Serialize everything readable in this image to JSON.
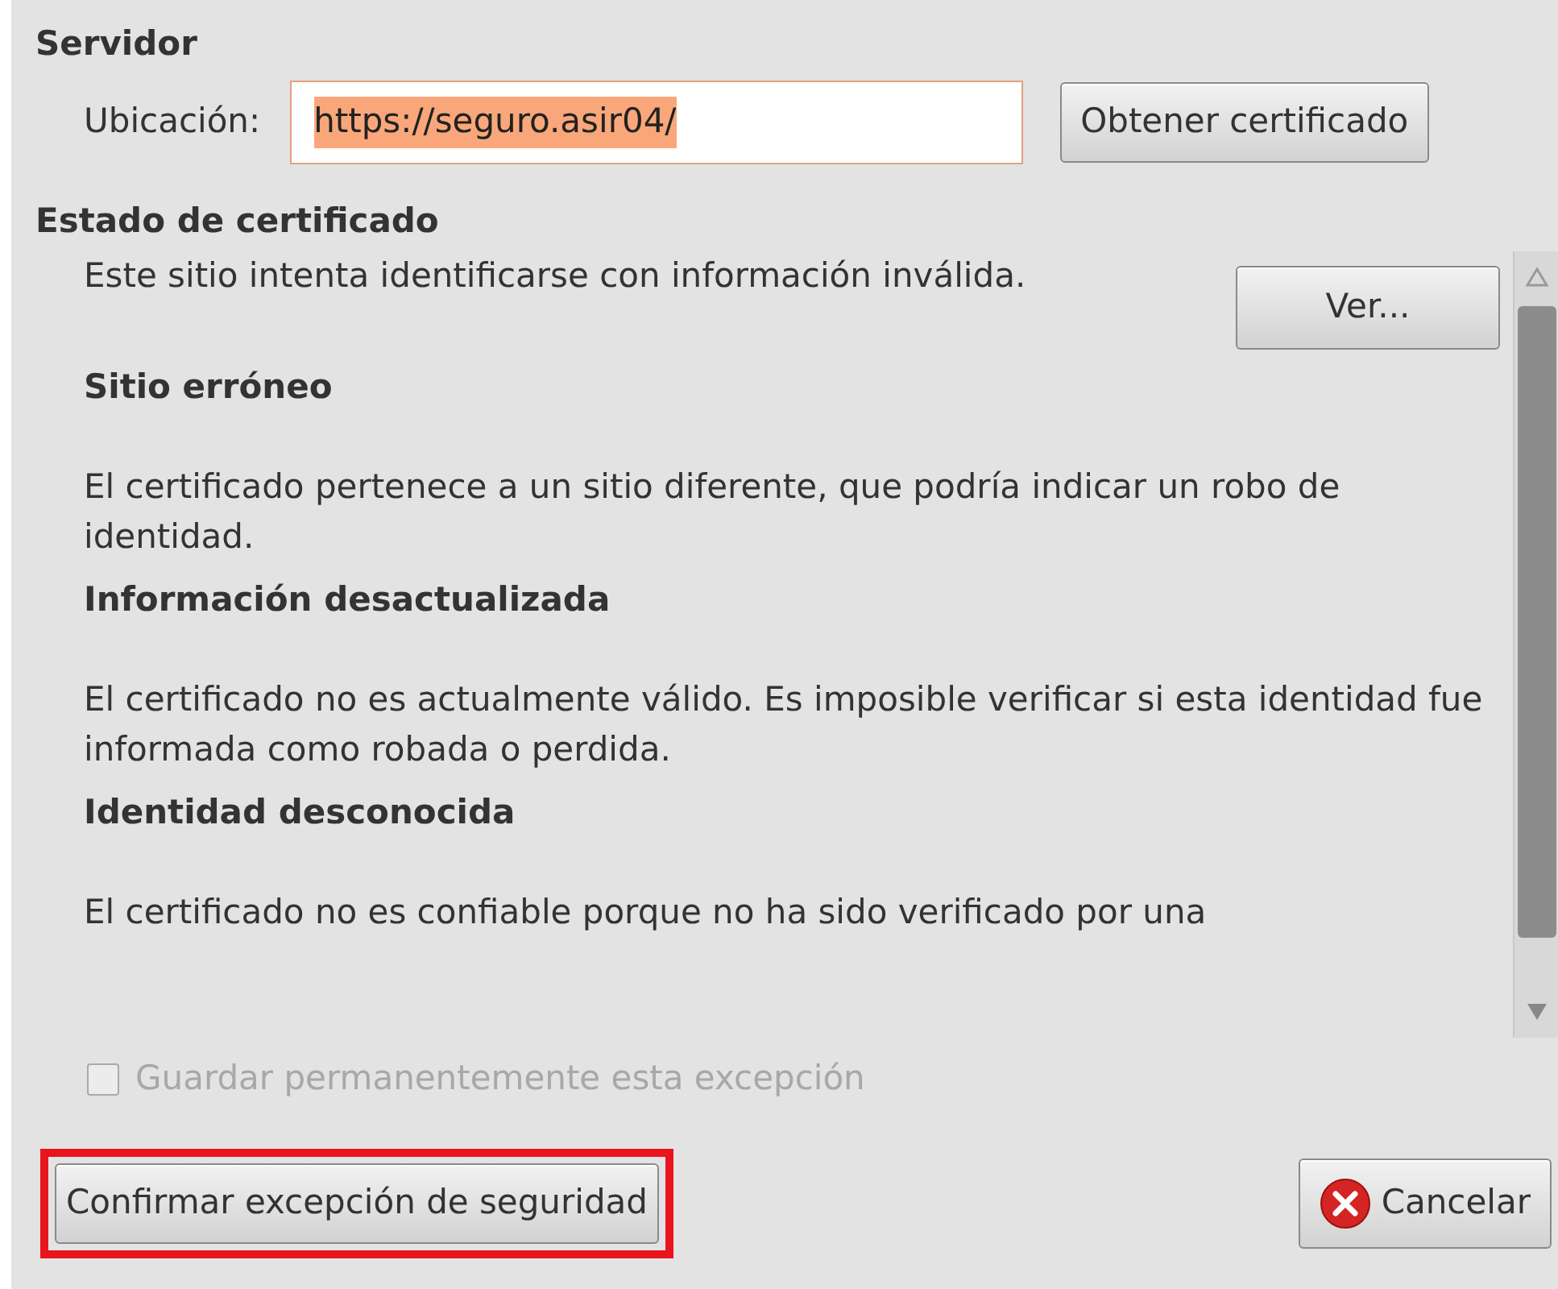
{
  "server": {
    "heading": "Servidor",
    "location_label": "Ubicación:",
    "location_value": "https://seguro.asir04/",
    "value_selected": true,
    "get_button": "Obtener certificado"
  },
  "status": {
    "heading": "Estado de certificado",
    "intro": "Este sitio intenta identificarse con información inválida.",
    "view_button": "Ver...",
    "sections": [
      {
        "title": "Sitio erróneo",
        "text": "El certificado pertenece a un sitio diferente, que podría indicar un robo de identidad."
      },
      {
        "title": "Información desactualizada",
        "text": "El certificado no es actualmente válido. Es imposible verificar si esta identidad fue informada como robada o perdida."
      },
      {
        "title": "Identidad desconocida",
        "text": "El certificado no es confiable porque no ha sido verificado por una"
      }
    ]
  },
  "permanent": {
    "label": "Guardar permanentemente esta excepción",
    "checked": false,
    "disabled": true
  },
  "confirm_button": {
    "label": "Confirmar excepción de seguridad",
    "highlighted": true
  },
  "cancel_button": {
    "label": "Cancelar"
  }
}
